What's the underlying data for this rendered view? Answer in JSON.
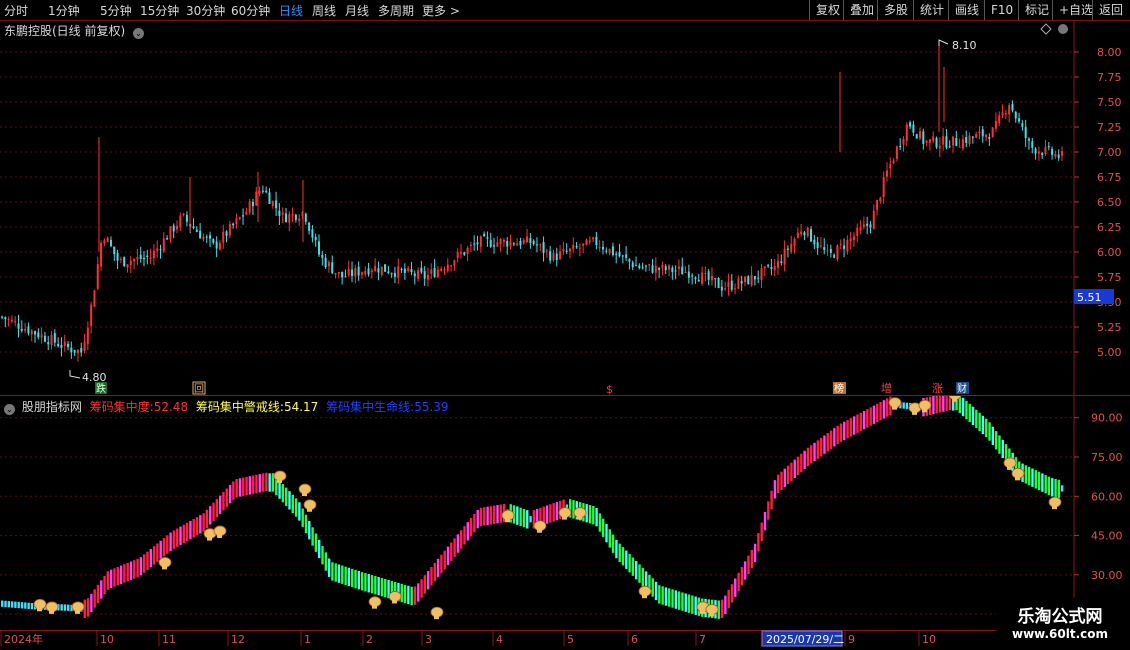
{
  "toolbar": {
    "left_items": [
      "分时",
      "1分钟",
      "5分钟",
      "15分钟",
      "30分钟",
      "60分钟",
      "日线",
      "周线",
      "月线",
      "多周期",
      "更多 >"
    ],
    "active_item": "日线",
    "right_items": [
      "复权",
      "叠加",
      "多股",
      "统计",
      "画线",
      "F10",
      "标记",
      "+自选",
      "返回"
    ]
  },
  "main_panel": {
    "title": "东鹏控股(日线 前复权)",
    "high_label": "8.10",
    "low_label": "4.80",
    "current_price": "5.51",
    "event_markers": [
      "跌",
      "回",
      "$",
      "榜",
      "增",
      "涨",
      "财"
    ],
    "colors": {
      "up": "#ff3030",
      "down": "#40e0e8",
      "grid": "#6a1010",
      "axis_text": "#e05050",
      "price_box": "#1838d8"
    }
  },
  "indicator_panel": {
    "title": "股朋指标网",
    "items": [
      {
        "label": "筹码集中度:",
        "value": "52.48",
        "color": "#ff3030"
      },
      {
        "label": "筹码集中警戒线:",
        "value": "54.17",
        "color": "#ffff40"
      },
      {
        "label": "筹码集中生命线:",
        "value": "55.39",
        "color": "#2040ff"
      }
    ]
  },
  "date_axis": {
    "labels": [
      "2024年",
      "10",
      "11",
      "12",
      "1",
      "2",
      "3",
      "4",
      "5",
      "6",
      "7",
      "2025/07/29/二",
      "9",
      "10"
    ],
    "highlight": "2025/07/29/二"
  },
  "watermark": {
    "line1": "乐淘公式网",
    "line2": "www.60lt.com"
  },
  "chart_data": [
    {
      "type": "candlestick",
      "title": "东鹏控股(日线 前复权)",
      "y_ticks": [
        5.0,
        5.25,
        5.5,
        5.75,
        6.0,
        6.25,
        6.5,
        6.75,
        7.0,
        7.25,
        7.5,
        7.75,
        8.0
      ],
      "ylim": [
        4.72,
        8.22
      ],
      "period_high": 8.1,
      "period_low": 4.8,
      "last_price": 5.51,
      "close_path_points": [
        [
          0,
          5.35
        ],
        [
          0.03,
          5.2
        ],
        [
          0.06,
          5.05
        ],
        [
          0.075,
          5.0
        ],
        [
          0.085,
          5.5
        ],
        [
          0.095,
          6.2
        ],
        [
          0.11,
          5.9
        ],
        [
          0.14,
          5.95
        ],
        [
          0.17,
          6.35
        ],
        [
          0.2,
          6.05
        ],
        [
          0.23,
          6.4
        ],
        [
          0.245,
          6.65
        ],
        [
          0.265,
          6.35
        ],
        [
          0.285,
          6.4
        ],
        [
          0.3,
          5.95
        ],
        [
          0.32,
          5.75
        ],
        [
          0.35,
          5.85
        ],
        [
          0.4,
          5.75
        ],
        [
          0.45,
          6.1
        ],
        [
          0.5,
          6.1
        ],
        [
          0.52,
          5.95
        ],
        [
          0.56,
          6.1
        ],
        [
          0.6,
          5.85
        ],
        [
          0.65,
          5.8
        ],
        [
          0.68,
          5.65
        ],
        [
          0.7,
          5.7
        ],
        [
          0.73,
          5.85
        ],
        [
          0.755,
          6.25
        ],
        [
          0.78,
          5.95
        ],
        [
          0.82,
          6.3
        ],
        [
          0.835,
          6.8
        ],
        [
          0.855,
          7.3
        ],
        [
          0.87,
          7.1
        ],
        [
          0.9,
          7.1
        ],
        [
          0.935,
          7.2
        ],
        [
          0.95,
          7.5
        ],
        [
          0.97,
          7.05
        ],
        [
          1.0,
          6.95
        ]
      ]
    },
    {
      "type": "line",
      "title": "股朋指标网",
      "y_ticks": [
        15.0,
        30.0,
        45.0,
        60.0,
        75.0,
        90.0
      ],
      "ylim": [
        12,
        96
      ],
      "series": [
        {
          "name": "筹码集中度",
          "last_value": 52.48
        },
        {
          "name": "筹码集中警戒线",
          "last_value": 54.17
        },
        {
          "name": "筹码集中生命线",
          "last_value": 55.39
        }
      ],
      "indicator_path_points": [
        [
          0,
          19
        ],
        [
          0.03,
          18
        ],
        [
          0.06,
          17.5
        ],
        [
          0.08,
          17
        ],
        [
          0.1,
          28
        ],
        [
          0.13,
          33
        ],
        [
          0.16,
          43
        ],
        [
          0.19,
          50
        ],
        [
          0.22,
          63
        ],
        [
          0.255,
          66
        ],
        [
          0.28,
          55
        ],
        [
          0.31,
          32
        ],
        [
          0.34,
          28
        ],
        [
          0.39,
          22
        ],
        [
          0.45,
          52
        ],
        [
          0.48,
          54
        ],
        [
          0.5,
          51
        ],
        [
          0.535,
          56
        ],
        [
          0.56,
          53
        ],
        [
          0.58,
          40
        ],
        [
          0.62,
          23
        ],
        [
          0.66,
          18
        ],
        [
          0.68,
          17
        ],
        [
          0.71,
          38
        ],
        [
          0.73,
          64
        ],
        [
          0.76,
          75
        ],
        [
          0.79,
          84
        ],
        [
          0.84,
          95
        ],
        [
          0.87,
          94
        ],
        [
          0.9,
          97
        ],
        [
          0.93,
          86
        ],
        [
          0.96,
          70
        ],
        [
          0.99,
          64
        ],
        [
          1.0,
          63
        ]
      ]
    }
  ]
}
